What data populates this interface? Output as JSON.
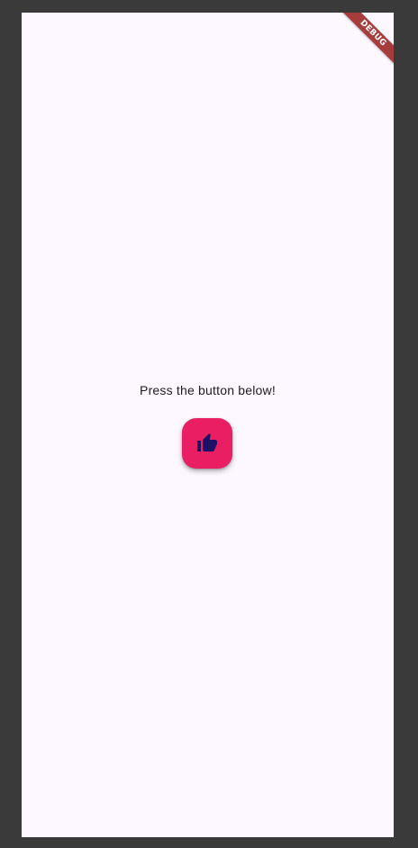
{
  "app": {
    "body_text": "Press the button below!",
    "fab": {
      "icon": "thumb-up-icon",
      "background_color": "#e91e63",
      "icon_color": "#1d1067"
    },
    "debug_banner": "DEBUG"
  },
  "colors": {
    "window_frame": "#3a3a3a",
    "screen_background": "#fdf7ff",
    "text": "#1d1b20",
    "debug_banner": "#a73c3c"
  }
}
